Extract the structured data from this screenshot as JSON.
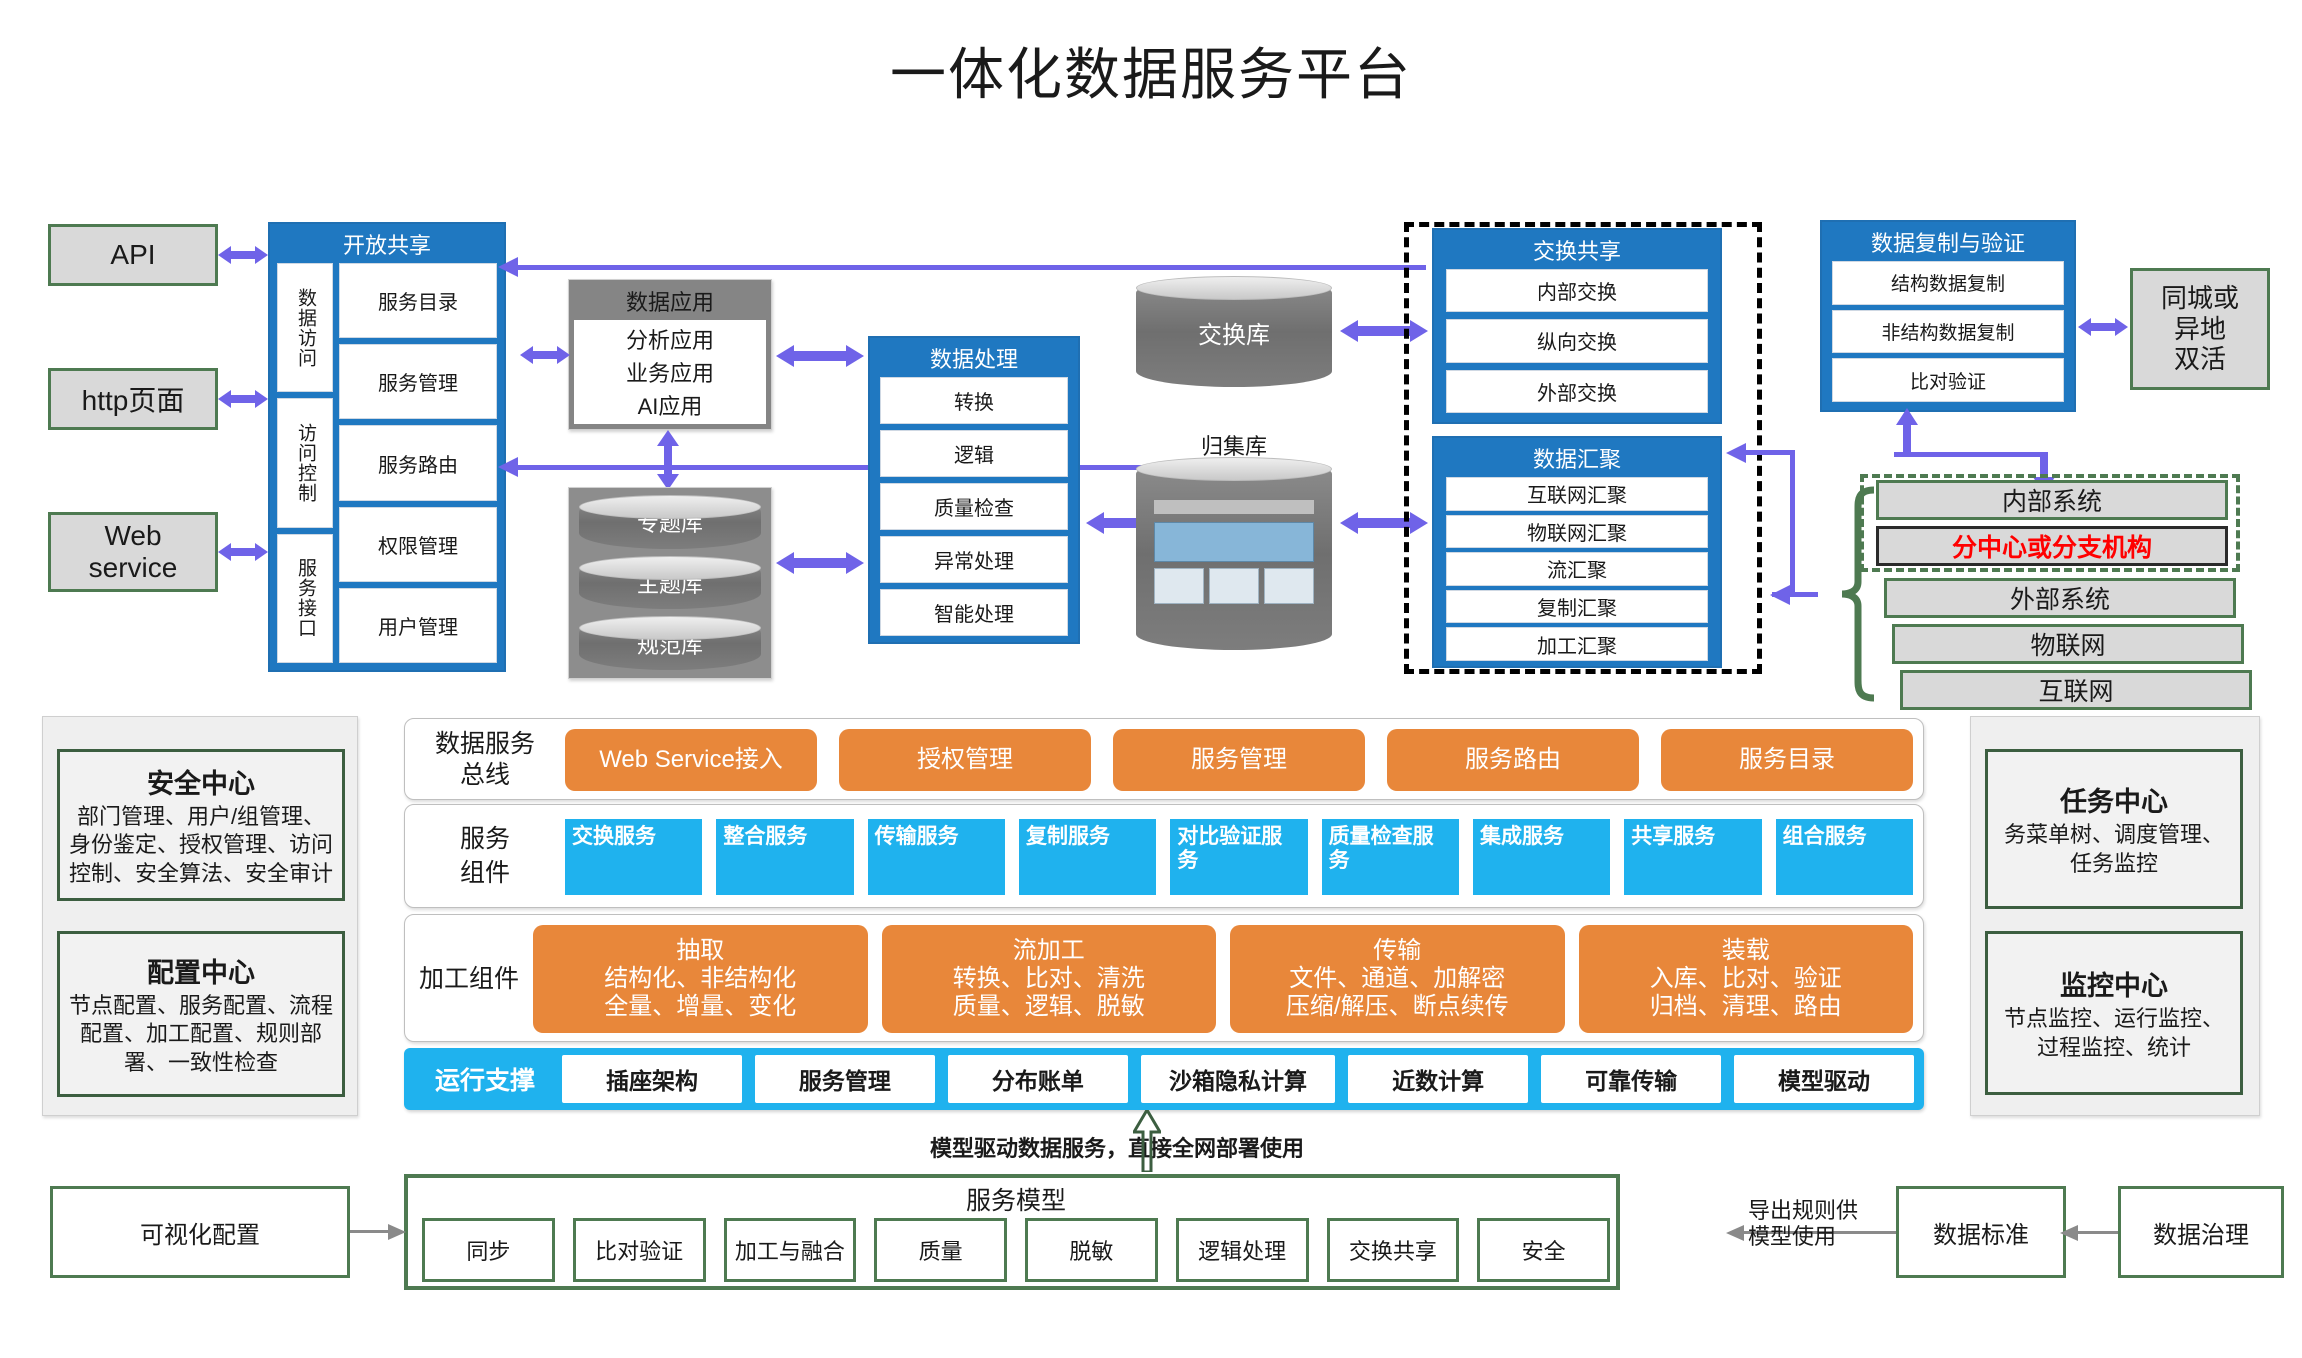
{
  "title": "一体化数据服务平台",
  "colors": {
    "blue_panel": "#1f78c1",
    "orange": "#e8873a",
    "cyan": "#1fb2ee",
    "green_border": "#4e7a51",
    "arrow_purple": "#6f63e8",
    "grey_box": "#d9d9d9",
    "red_text": "#ff0000"
  },
  "left_clients": [
    {
      "label": "API"
    },
    {
      "label": "http页面"
    },
    {
      "label": "Web\nservice"
    }
  ],
  "open_share": {
    "title": "开放共享",
    "left_column": [
      "数据访问",
      "访问控制",
      "服务接口"
    ],
    "right_column": [
      "服务目录",
      "服务管理",
      "服务路由",
      "权限管理",
      "用户管理"
    ]
  },
  "data_application": {
    "title": "数据应用",
    "items": [
      "分析应用",
      "业务应用",
      "AI应用"
    ]
  },
  "libraries": [
    "专题库",
    "主题库",
    "规范库"
  ],
  "data_processing": {
    "title": "数据处理",
    "items": [
      "转换",
      "逻辑",
      "质量检查",
      "异常处理",
      "智能处理"
    ]
  },
  "stores": [
    {
      "label": "交换库"
    },
    {
      "label": "归集库"
    }
  ],
  "exchange_share": {
    "title": "交换共享",
    "items": [
      "内部交换",
      "纵向交换",
      "外部交换"
    ]
  },
  "data_aggregation": {
    "title": "数据汇聚",
    "items": [
      "互联网汇聚",
      "物联网汇聚",
      "流汇聚",
      "复制汇聚",
      "加工汇聚"
    ]
  },
  "replication": {
    "title": "数据复制与验证",
    "items": [
      "结构数据复制",
      "非结构数据复制",
      "比对验证"
    ]
  },
  "dual_active": {
    "label": "同城或\n异地\n双活"
  },
  "systems": [
    {
      "label": "内部系统",
      "highlight": false
    },
    {
      "label": "分中心或分支机构",
      "highlight": true
    },
    {
      "label": "外部系统",
      "highlight": false
    },
    {
      "label": "物联网",
      "highlight": false
    },
    {
      "label": "互联网",
      "highlight": false
    }
  ],
  "security_center": {
    "title": "安全中心",
    "body": "部门管理、用户/组管理、身份鉴定、授权管理、访问控制、安全算法、安全审计"
  },
  "config_center": {
    "title": "配置中心",
    "body": "节点配置、服务配置、流程配置、加工配置、规则部署、一致性检查"
  },
  "task_center": {
    "title": "任务中心",
    "body": "务菜单树、调度管理、任务监控"
  },
  "monitor_center": {
    "title": "监控中心",
    "body": "节点监控、运行监控、过程监控、统计"
  },
  "service_bus": {
    "row_label": "数据服务\n总线",
    "items": [
      "Web Service接入",
      "授权管理",
      "服务管理",
      "服务路由",
      "服务目录"
    ]
  },
  "service_components": {
    "row_label": "服务\n组件",
    "items": [
      "交换服务",
      "整合服务",
      "传输服务",
      "复制服务",
      "对比验证服务",
      "质量检查服务",
      "集成服务",
      "共享服务",
      "组合服务"
    ]
  },
  "processing_components": {
    "row_label": "加工组件",
    "items": [
      {
        "title": "抽取",
        "lines": [
          "结构化、非结构化",
          "全量、增量、变化"
        ]
      },
      {
        "title": "流加工",
        "lines": [
          "转换、比对、清洗",
          "质量、逻辑、脱敏"
        ]
      },
      {
        "title": "传输",
        "lines": [
          "文件、通道、加解密",
          "压缩/解压、断点续传"
        ]
      },
      {
        "title": "装载",
        "lines": [
          "入库、比对、验证",
          "归档、清理、路由"
        ]
      }
    ]
  },
  "runtime_support": {
    "row_label": "运行支撑",
    "items": [
      "插座架构",
      "服务管理",
      "分布账单",
      "沙箱隐私计算",
      "近数计算",
      "可靠传输",
      "模型驱动"
    ]
  },
  "service_model": {
    "title": "服务模型",
    "items": [
      "同步",
      "比对验证",
      "加工与融合",
      "质量",
      "脱敏",
      "逻辑处理",
      "交换共享",
      "安全"
    ]
  },
  "bottom_left": {
    "label": "可视化配置"
  },
  "bottom_right": [
    {
      "label": "数据标准"
    },
    {
      "label": "数据治理"
    }
  ],
  "annotations": {
    "model_driven": "模型驱动数据服务，直接全网部署使用",
    "export_rules": "导出规则供\n模型使用"
  }
}
